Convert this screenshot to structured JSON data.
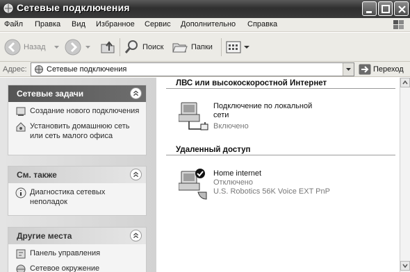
{
  "window": {
    "title": "Сетевые подключения"
  },
  "menu": [
    "Файл",
    "Правка",
    "Вид",
    "Избранное",
    "Сервис",
    "Дополнительно",
    "Справка"
  ],
  "toolbar": {
    "back": "Назад",
    "search": "Поиск",
    "folders": "Папки"
  },
  "address": {
    "label": "Адрес:",
    "value": "Сетевые подключения",
    "go": "Переход"
  },
  "left": {
    "tasks": {
      "title": "Сетевые задачи",
      "items": [
        "Создание нового подключения",
        "Установить домашнюю сеть или сеть малого офиса"
      ]
    },
    "see_also": {
      "title": "См. также",
      "items": [
        "Диагностика сетевых неполадок"
      ]
    },
    "other": {
      "title": "Другие места",
      "items": [
        "Панель управления",
        "Сетевое окружение"
      ]
    }
  },
  "right": {
    "lan": {
      "header": "ЛВС или высокоскоростной Интернет",
      "item": {
        "name": "Подключение по локальной сети",
        "status": "Включено"
      }
    },
    "dialup": {
      "header": "Удаленный доступ",
      "item": {
        "name": "Home internet",
        "status": "Отключено",
        "device": "U.S. Robotics 56K Voice EXT PnP"
      }
    }
  }
}
